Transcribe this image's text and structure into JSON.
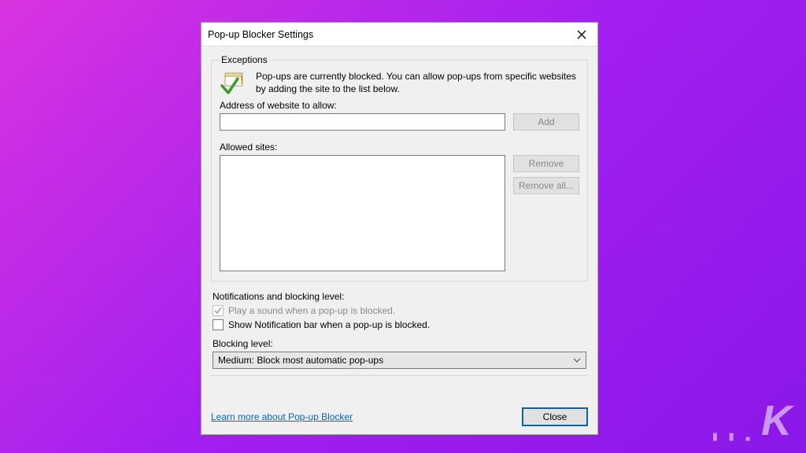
{
  "dialog": {
    "title": "Pop-up Blocker Settings",
    "exceptions": {
      "legend": "Exceptions",
      "description": "Pop-ups are currently blocked.  You can allow pop-ups from specific websites by adding the site to the list below.",
      "address_label": "Address of website to allow:",
      "address_value": "",
      "add_btn": "Add",
      "allowed_label": "Allowed sites:",
      "remove_btn": "Remove",
      "remove_all_btn": "Remove all..."
    },
    "notifications": {
      "legend": "Notifications and blocking level:",
      "play_sound_label": "Play a sound when a pop-up is blocked.",
      "play_sound_checked": true,
      "play_sound_enabled": false,
      "show_bar_label": "Show Notification bar when a pop-up is blocked.",
      "show_bar_checked": false,
      "blocking_level_label": "Blocking level:",
      "blocking_level_value": "Medium: Block most automatic pop-ups"
    },
    "footer": {
      "learn_more": "Learn more about Pop-up Blocker",
      "close": "Close"
    }
  },
  "branding": {
    "mark": "K"
  }
}
